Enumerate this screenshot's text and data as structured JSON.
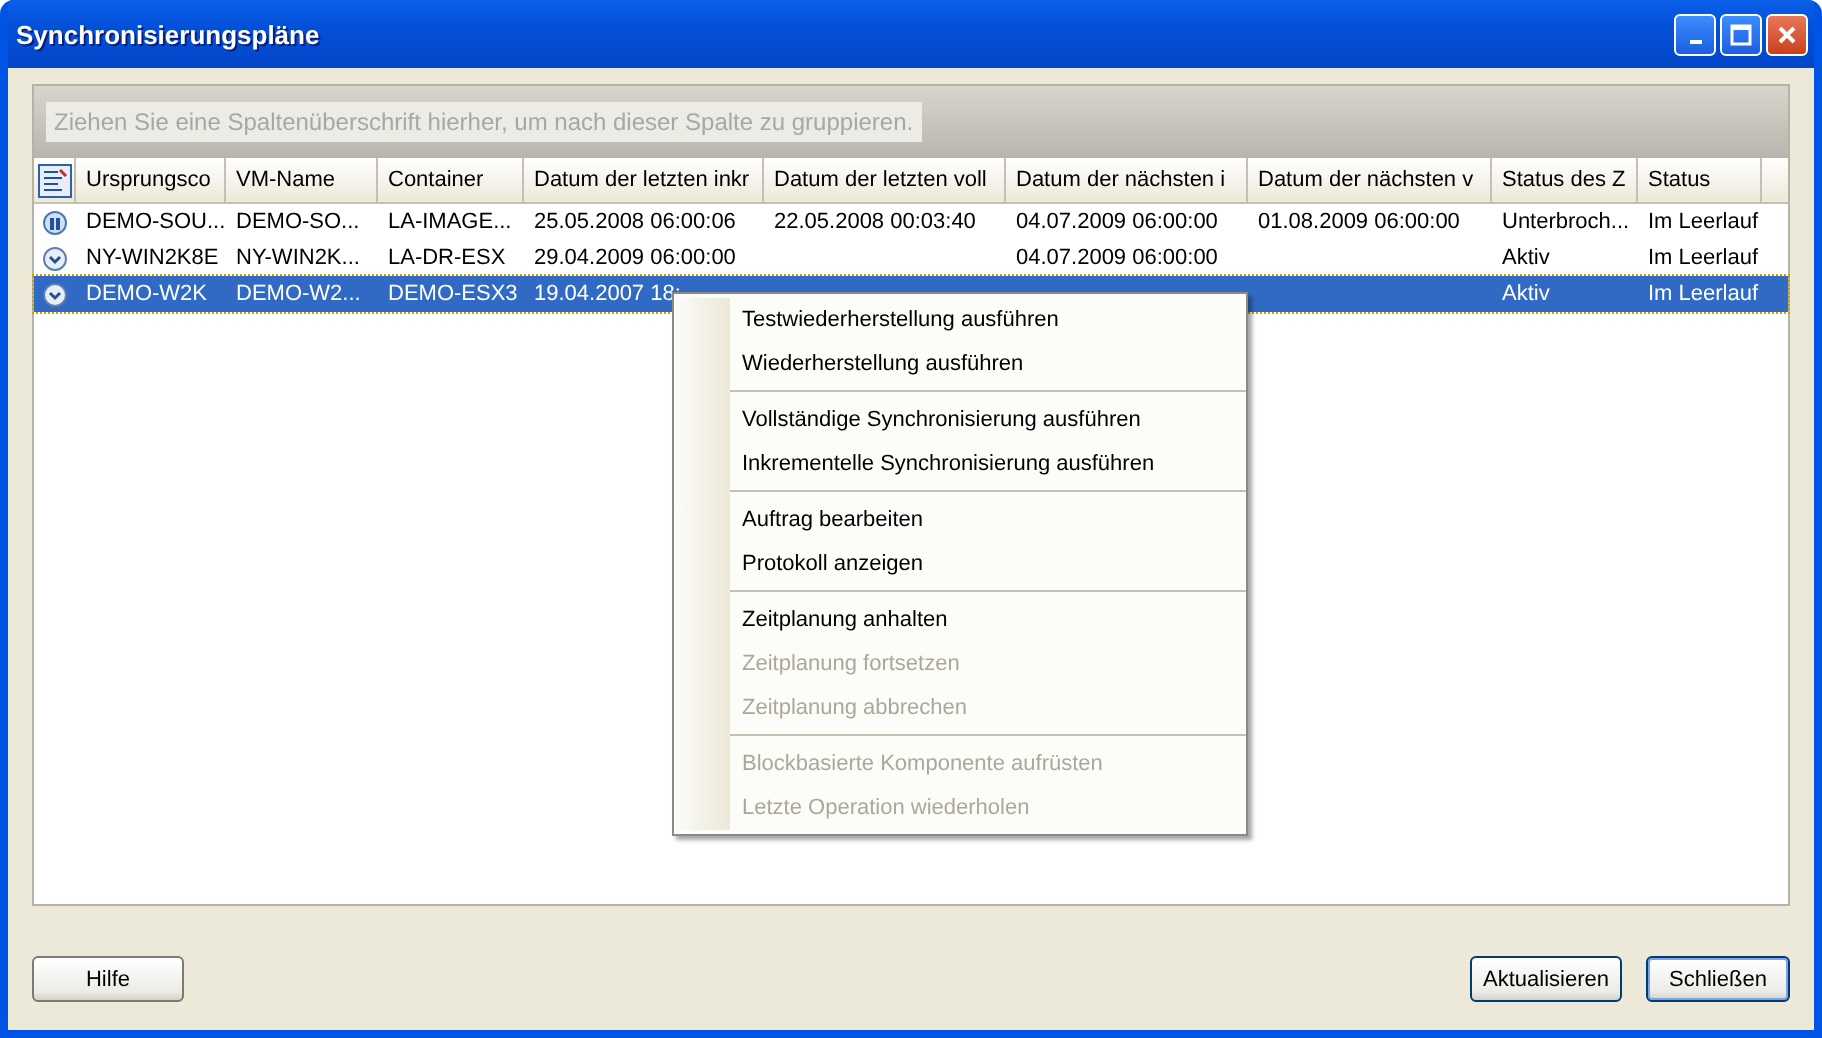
{
  "window": {
    "title": "Synchronisierungspläne"
  },
  "group_hint": "Ziehen Sie eine Spaltenüberschrift hierher, um nach dieser Spalte zu gruppieren.",
  "columns": [
    "Ursprungsco",
    "VM-Name",
    "Container",
    "Datum der letzten inkr",
    "Datum der letzten voll",
    "Datum der nächsten i",
    "Datum der nächsten v",
    "Status des Z",
    "Status"
  ],
  "rows": [
    {
      "kind": "paused",
      "selected": false,
      "cells": [
        "DEMO-SOU...",
        "DEMO-SO...",
        "LA-IMAGE...",
        "25.05.2008 06:00:06",
        "22.05.2008 00:03:40",
        "04.07.2009 06:00:00",
        "01.08.2009 06:00:00",
        "Unterbroch...",
        "Im Leerlauf"
      ]
    },
    {
      "kind": "scheduled",
      "selected": false,
      "cells": [
        "NY-WIN2K8E",
        "NY-WIN2K...",
        "LA-DR-ESX",
        "29.04.2009 06:00:00",
        "",
        "04.07.2009 06:00:00",
        "",
        "Aktiv",
        "Im Leerlauf"
      ]
    },
    {
      "kind": "scheduled",
      "selected": true,
      "cells": [
        "DEMO-W2K",
        "DEMO-W2...",
        "DEMO-ESX3",
        "19.04.2007 18:",
        "",
        "",
        "",
        "Aktiv",
        "Im Leerlauf"
      ]
    }
  ],
  "context_menu": [
    [
      {
        "label": "Testwiederherstellung ausführen",
        "disabled": false
      },
      {
        "label": "Wiederherstellung ausführen",
        "disabled": false
      }
    ],
    [
      {
        "label": "Vollständige Synchronisierung ausführen",
        "disabled": false
      },
      {
        "label": "Inkrementelle Synchronisierung ausführen",
        "disabled": false
      }
    ],
    [
      {
        "label": "Auftrag bearbeiten",
        "disabled": false
      },
      {
        "label": "Protokoll anzeigen",
        "disabled": false
      }
    ],
    [
      {
        "label": "Zeitplanung anhalten",
        "disabled": false
      },
      {
        "label": "Zeitplanung fortsetzen",
        "disabled": true
      },
      {
        "label": "Zeitplanung abbrechen",
        "disabled": true
      }
    ],
    [
      {
        "label": "Blockbasierte Komponente aufrüsten",
        "disabled": true
      },
      {
        "label": "Letzte Operation wiederholen",
        "disabled": true
      }
    ]
  ],
  "buttons": {
    "help": "Hilfe",
    "refresh": "Aktualisieren",
    "close": "Schließen"
  }
}
